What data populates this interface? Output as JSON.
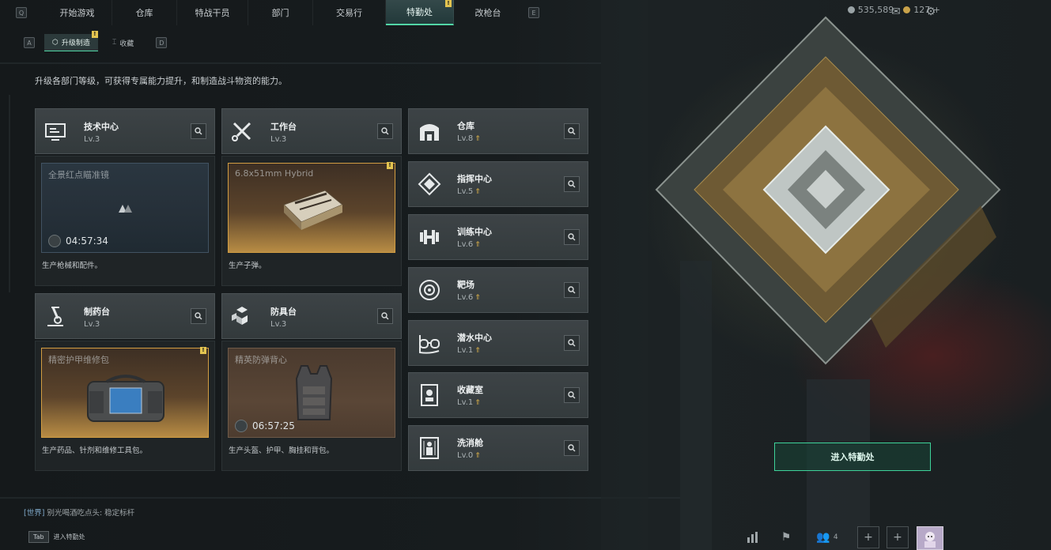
{
  "nav": {
    "left_key": "Q",
    "right_key": "E",
    "tabs": [
      {
        "label": "开始游戏"
      },
      {
        "label": "仓库"
      },
      {
        "label": "特战干员"
      },
      {
        "label": "部门"
      },
      {
        "label": "交易行"
      },
      {
        "label": "特勤处",
        "active": true,
        "badge": "!"
      },
      {
        "label": "改枪台"
      }
    ]
  },
  "subnav": {
    "left_key": "A",
    "right_key": "D",
    "tabs": [
      {
        "label": "升级制造",
        "active": true,
        "badge": "!"
      },
      {
        "label": "收藏"
      }
    ]
  },
  "currency": {
    "coins": "535,589",
    "tokens": "127",
    "tokens_plus": "+"
  },
  "description": "升级各部门等级，可获得专属能力提升，和制造战斗物资的能力。",
  "stations": [
    {
      "name": "技术中心",
      "level": "Lv.3",
      "icon": "tech-center-icon",
      "product_name": "全景红点瞄准镜",
      "timer": "04:57:34",
      "style": "blue",
      "product_desc": "生产枪械和配件。"
    },
    {
      "name": "工作台",
      "level": "Lv.3",
      "icon": "workbench-icon",
      "product_name": "6.8x51mm Hybrid",
      "timer": "",
      "style": "gold",
      "badge": "!",
      "product_desc": "生产子弹。"
    },
    {
      "name": "制药台",
      "level": "Lv.3",
      "icon": "pharmacy-icon",
      "product_name": "精密护甲维修包",
      "timer": "",
      "style": "gold",
      "badge": "!",
      "product_desc": "生产药品、针剂和维修工具包。"
    },
    {
      "name": "防具台",
      "level": "Lv.3",
      "icon": "armor-bench-icon",
      "product_name": "精英防弹背心",
      "timer": "06:57:25",
      "style": "brown",
      "product_desc": "生产头盔、护甲、胸挂和背包。"
    }
  ],
  "facilities": [
    {
      "name": "仓库",
      "level": "Lv.8",
      "icon": "warehouse-icon"
    },
    {
      "name": "指挥中心",
      "level": "Lv.5",
      "icon": "command-center-icon"
    },
    {
      "name": "训练中心",
      "level": "Lv.6",
      "icon": "training-center-icon"
    },
    {
      "name": "靶场",
      "level": "Lv.6",
      "icon": "shooting-range-icon"
    },
    {
      "name": "潜水中心",
      "level": "Lv.1",
      "icon": "diving-center-icon"
    },
    {
      "name": "收藏室",
      "level": "Lv.1",
      "icon": "collection-room-icon"
    },
    {
      "name": "洗消舱",
      "level": "Lv.0",
      "icon": "decon-chamber-icon"
    }
  ],
  "enter_button": "进入特勤处",
  "chat": {
    "channel": "[世界]",
    "message": "别光喝酒吃点头: 稳定标杆"
  },
  "bottom_hint": {
    "key": "Tab",
    "label": "进入特勤处"
  },
  "bottom_right": {
    "friends_count": "4"
  },
  "colors": {
    "accent": "#52d6a6",
    "badge": "#e3c450",
    "upgrade": "#e0b54a"
  }
}
